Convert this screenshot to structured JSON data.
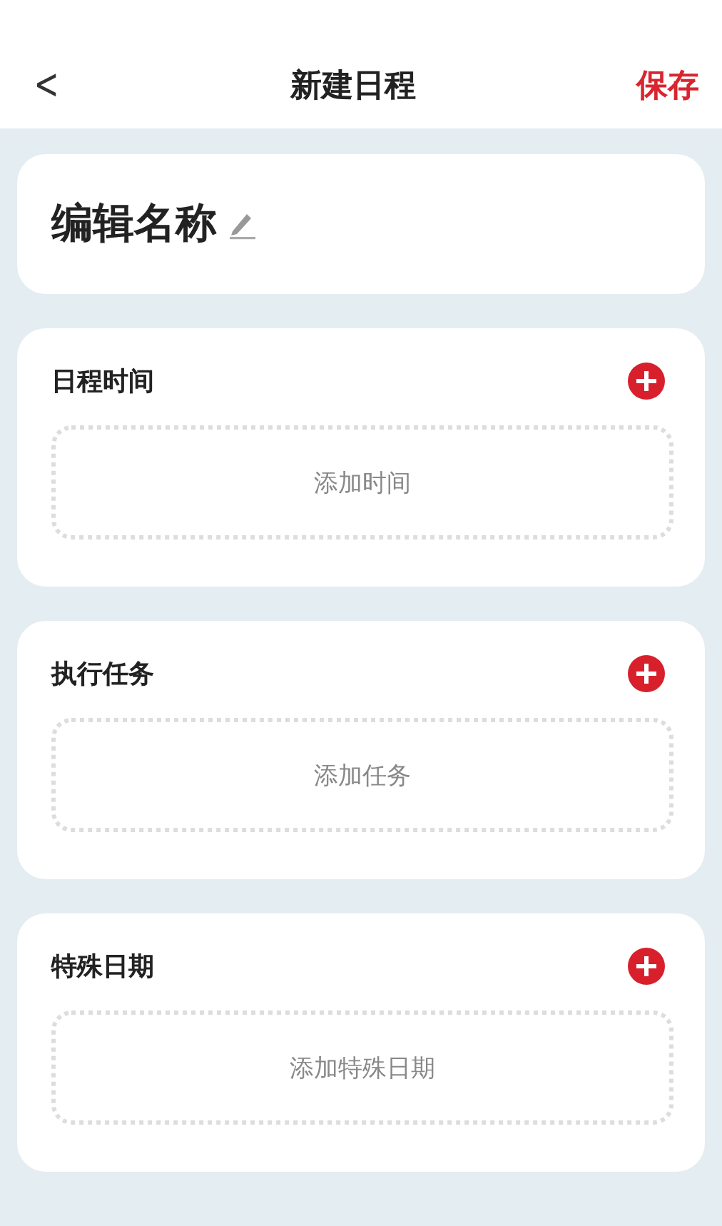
{
  "header": {
    "back": "<",
    "title": "新建日程",
    "action": "保存"
  },
  "name_card": {
    "name": "编辑名称"
  },
  "sections": [
    {
      "title": "日程时间",
      "placeholder": "添加时间"
    },
    {
      "title": "执行任务",
      "placeholder": "添加任务"
    },
    {
      "title": "特殊日期",
      "placeholder": "添加特殊日期"
    }
  ]
}
